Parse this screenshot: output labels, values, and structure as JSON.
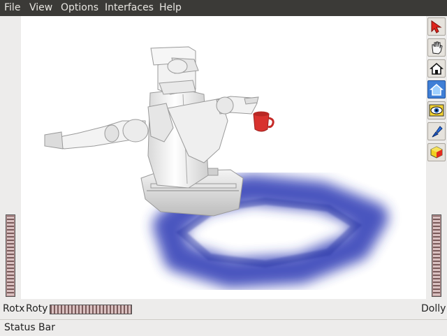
{
  "menu": [
    {
      "id": "file",
      "label": "File"
    },
    {
      "id": "view",
      "label": "View"
    },
    {
      "id": "options",
      "label": "Options"
    },
    {
      "id": "interfaces",
      "label": "Interfaces"
    },
    {
      "id": "help",
      "label": "Help"
    }
  ],
  "toolbar": {
    "tools": [
      "pick-arrow-icon",
      "hand-icon",
      "home-icon",
      "set-home-icon",
      "view-all-icon",
      "seek-icon",
      "perspective-icon"
    ],
    "active_tool": "set-home-icon"
  },
  "wheels": {
    "rotx_label": "Rotx",
    "roty_label": "Roty",
    "dolly_label": "Dolly"
  },
  "status": {
    "text": "Status Bar"
  },
  "colors": {
    "menubar_bg": "#3b3a37",
    "viewport_bg": "#ffffff",
    "wheel_color": "#c8a8a8",
    "mug_red": "#d8322e",
    "ring_blue": "#2233aa"
  }
}
